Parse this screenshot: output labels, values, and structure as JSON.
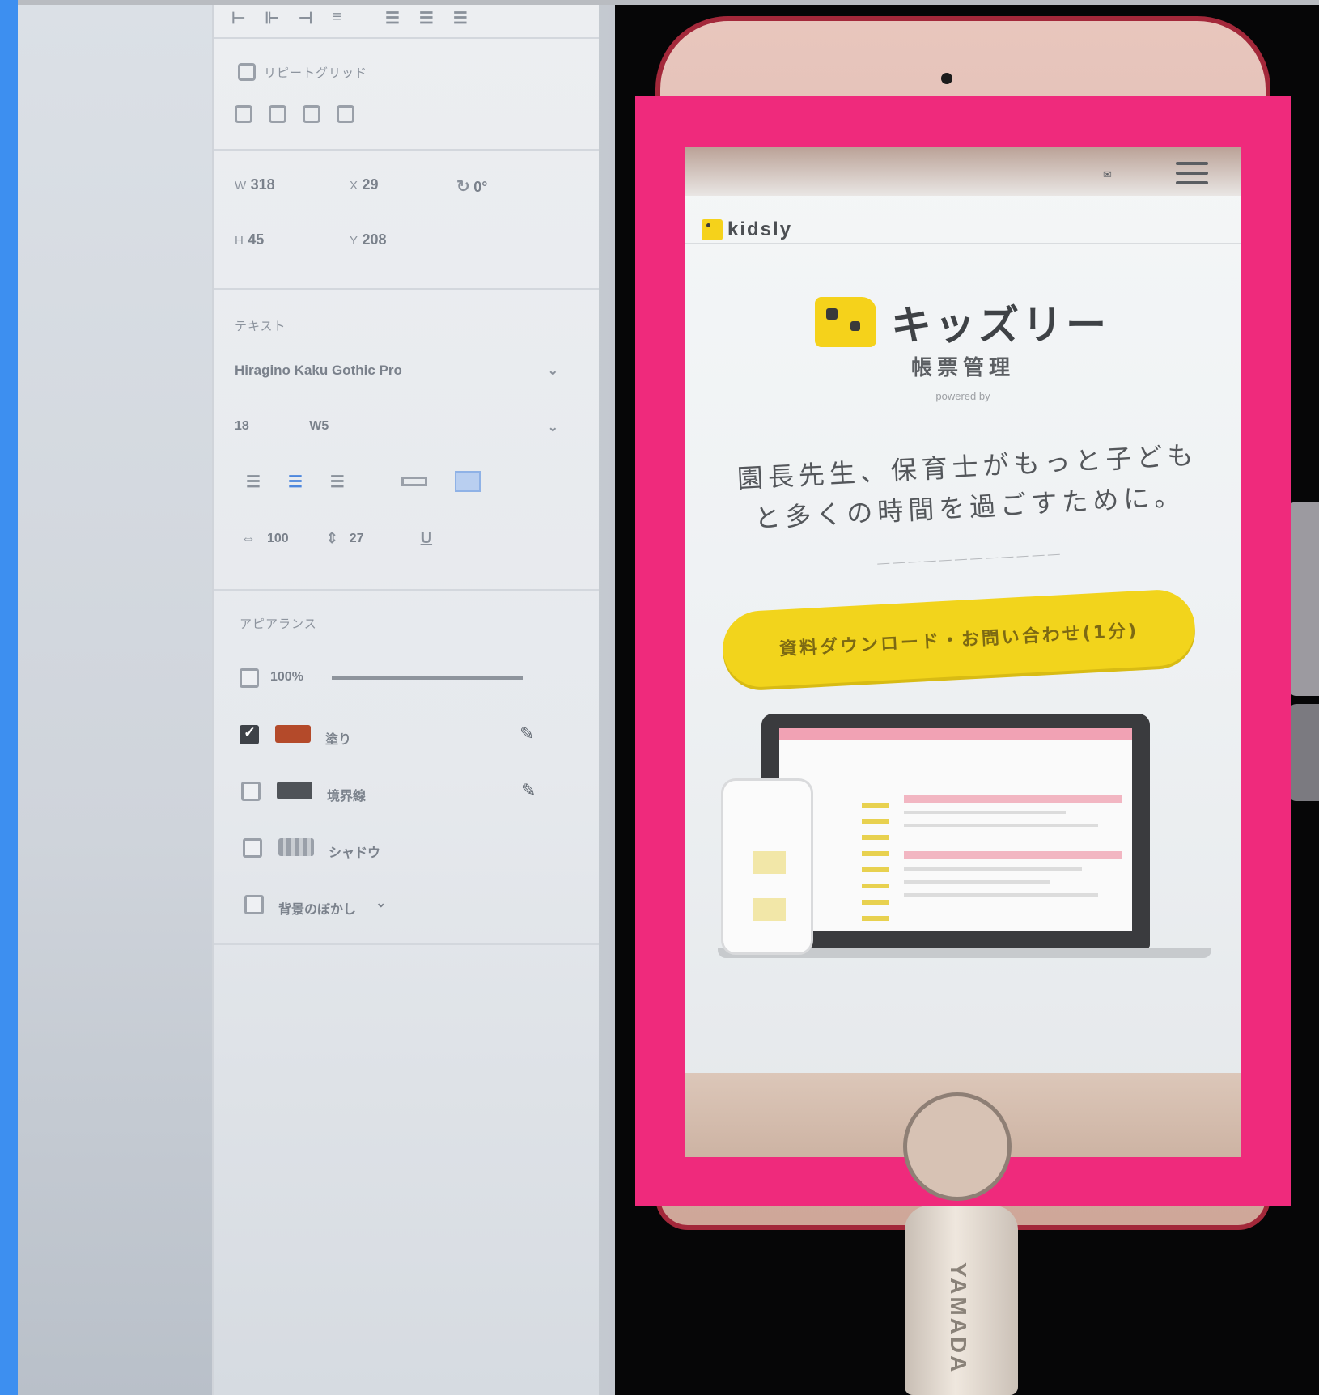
{
  "design_panel": {
    "repeat_grid_label": "リピートグリッド",
    "transform": {
      "w": "318",
      "x": "29",
      "rotation": "0°",
      "h": "45",
      "y": "208"
    },
    "text_section_label": "テキスト",
    "font_family": "Hiragino Kaku Gothic Pro",
    "font_size": "18",
    "font_weight": "W5",
    "char_spacing": "100",
    "line_spacing": "27",
    "underline_icon_label": "U",
    "appearance_label": "アピアランス",
    "opacity": "100%",
    "fill_label": "塗り",
    "border_label": "境界線",
    "shadow_label": "シャドウ",
    "blur_label": "背景のぼかし",
    "colors": {
      "fill": "#b44a2a",
      "border": "#4f5358"
    }
  },
  "phone_site": {
    "logo": "kidsly",
    "brand_name": "キッズリー",
    "brand_sub": "帳票管理",
    "powered_by": "powered by",
    "headline_line1": "園長先生、保育士がもっと子ども",
    "headline_line2": "と多くの時間を過ごすために。",
    "cta_label": "資料ダウンロード・お問い合わせ(1分)",
    "accent_color": "#f2d41c",
    "highlight_color": "#ef2a7c"
  },
  "cable_text": "YAMADA"
}
